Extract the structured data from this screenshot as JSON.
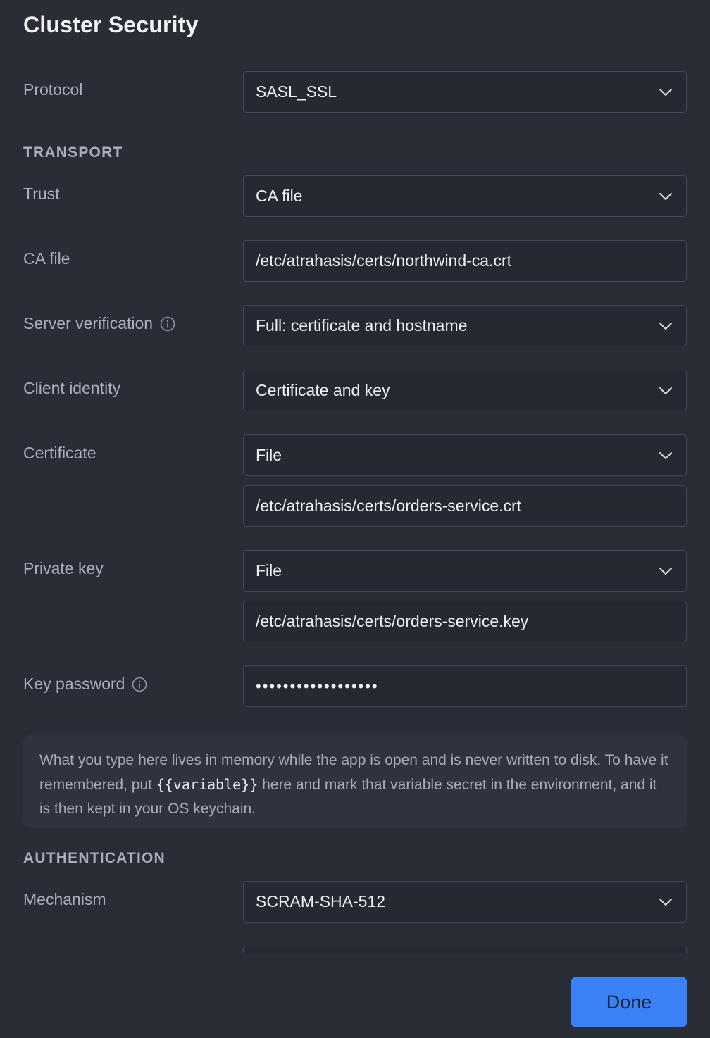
{
  "dialog": {
    "title": "Cluster Security"
  },
  "protocol": {
    "label": "Protocol",
    "value": "SASL_SSL"
  },
  "transport": {
    "heading": "TRANSPORT",
    "trust": {
      "label": "Trust",
      "value": "CA file"
    },
    "ca_file": {
      "label": "CA file",
      "value": "/etc/atrahasis/certs/northwind-ca.crt"
    },
    "server_verification": {
      "label": "Server verification",
      "value": "Full: certificate and hostname"
    },
    "client_identity": {
      "label": "Client identity",
      "value": "Certificate and key"
    },
    "certificate": {
      "label": "Certificate",
      "source": "File",
      "path": "/etc/atrahasis/certs/orders-service.crt"
    },
    "private_key": {
      "label": "Private key",
      "source": "File",
      "path": "/etc/atrahasis/certs/orders-service.key"
    },
    "key_password": {
      "label": "Key password",
      "value": "••••••••••••••••••"
    },
    "note": {
      "part1": "What you type here lives in memory while the app is open and is never written to disk. To have it remembered, put ",
      "code": "{{variable}}",
      "part2": " here and mark that variable secret in the environment, and it is then kept in your OS keychain."
    }
  },
  "authentication": {
    "heading": "AUTHENTICATION",
    "mechanism": {
      "label": "Mechanism",
      "value": "SCRAM-SHA-512"
    }
  },
  "footer": {
    "done_label": "Done"
  },
  "icons": {
    "chevron": "chevron-down-icon",
    "info": "info-icon"
  },
  "colors": {
    "background": "#2a2d36",
    "field_border": "#454955",
    "accent": "#3b82f6",
    "label": "#a9b0bc"
  }
}
